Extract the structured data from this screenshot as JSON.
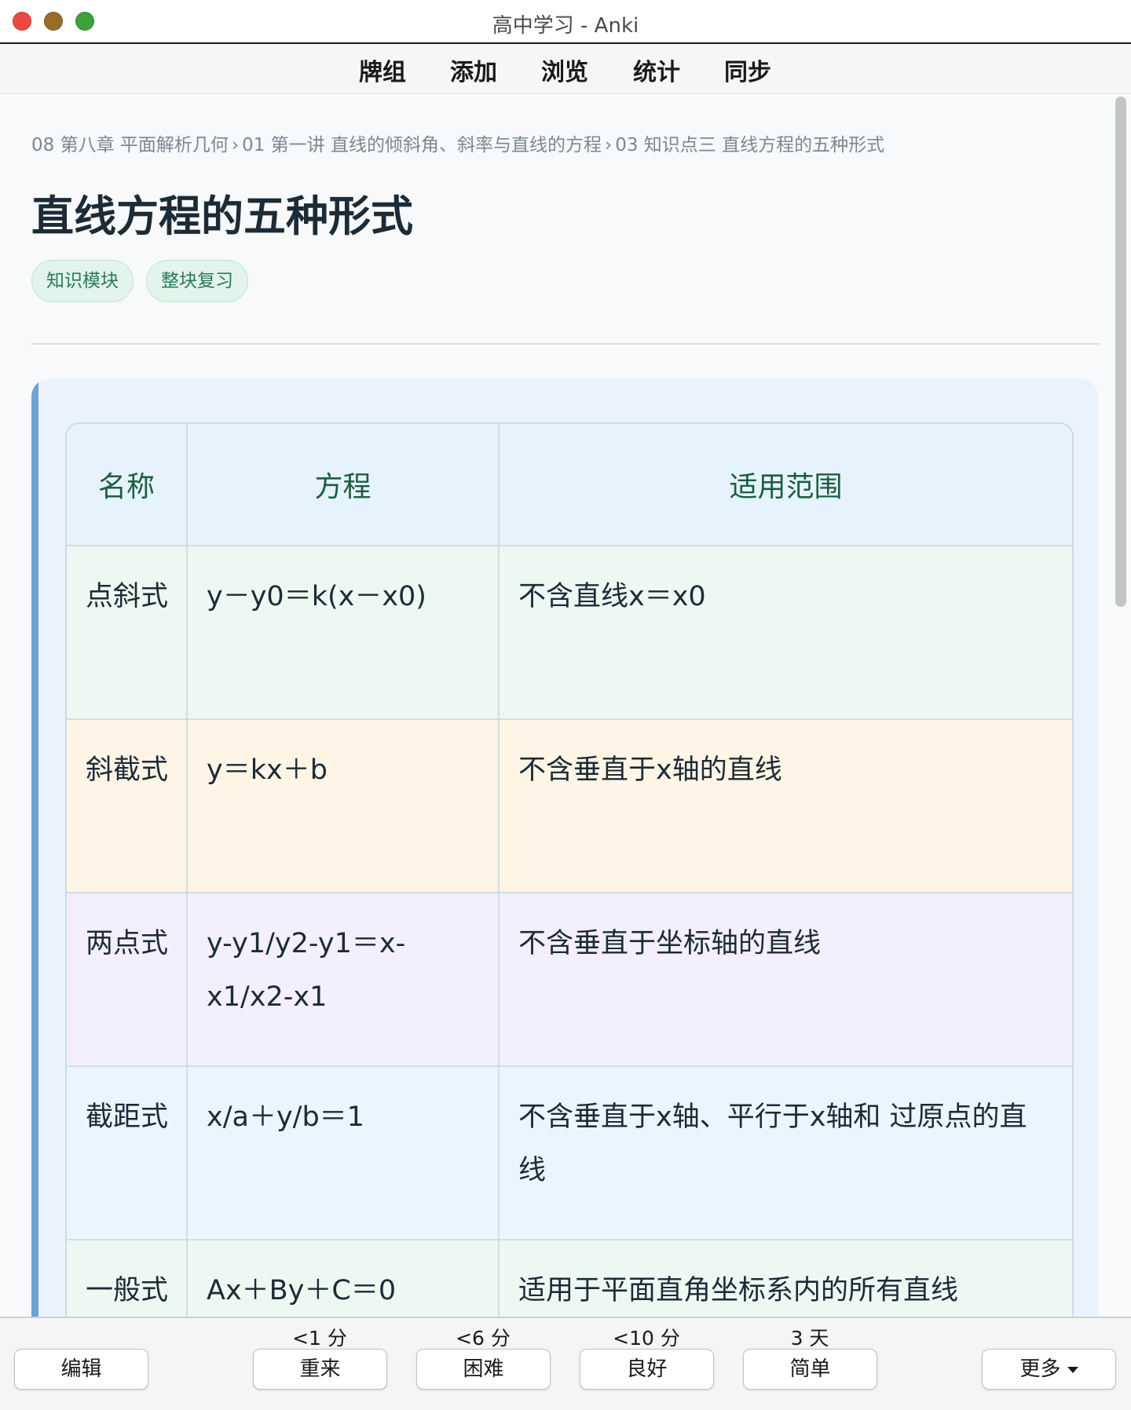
{
  "window": {
    "title": "高中学习 - Anki"
  },
  "toolbar": {
    "items": [
      "牌组",
      "添加",
      "浏览",
      "统计",
      "同步"
    ]
  },
  "card": {
    "breadcrumb": {
      "parts": [
        "08 第八章 平面解析几何",
        "01 第一讲 直线的倾斜角、斜率与直线的方程",
        "03 知识点三 直线方程的五种形式"
      ],
      "separator": "›"
    },
    "title": "直线方程的五种形式",
    "tags": [
      "知识模块",
      "整块复习"
    ],
    "table": {
      "headers": [
        "名称",
        "方程",
        "适用范围"
      ],
      "rows": [
        {
          "name": "点斜式",
          "equation": "y－y0＝k(x－x0)",
          "scope": "不含直线x＝x0"
        },
        {
          "name": "斜截式",
          "equation": "y＝kx＋b",
          "scope": "不含垂直于x轴的直线"
        },
        {
          "name": "两点式",
          "equation": "y-y1/y2-y1＝x-x1/x2-x1",
          "scope": "不含垂直于坐标轴的直线"
        },
        {
          "name": "截距式",
          "equation": "x/a＋y/b＝1",
          "scope": "不含垂直于x轴、平行于x轴和 过原点的直线"
        },
        {
          "name": "一般式",
          "equation": "Ax＋By＋C＝0",
          "scope": "适用于平面直角坐标系内的所有直线"
        }
      ]
    }
  },
  "answer_bar": {
    "edit_label": "编辑",
    "more_label": "更多",
    "buttons": [
      {
        "label": "重来",
        "interval": "<1 分"
      },
      {
        "label": "困难",
        "interval": "<6 分"
      },
      {
        "label": "良好",
        "interval": "<10 分"
      },
      {
        "label": "简单",
        "interval": "3 天"
      }
    ]
  },
  "colors": {
    "accent_bar": "#6ea2d3",
    "tag_bg": "#e2f4ec",
    "tag_text": "#2a7a55",
    "header_text": "#1d5d40",
    "row_green": "#eef8f2",
    "row_orange": "#fff5e6",
    "row_purple": "#f3efff",
    "row_blue": "#eaf5fd",
    "traffic_close": "#ec4a40",
    "traffic_min": "#9a6c2c",
    "traffic_max": "#3da13e"
  }
}
